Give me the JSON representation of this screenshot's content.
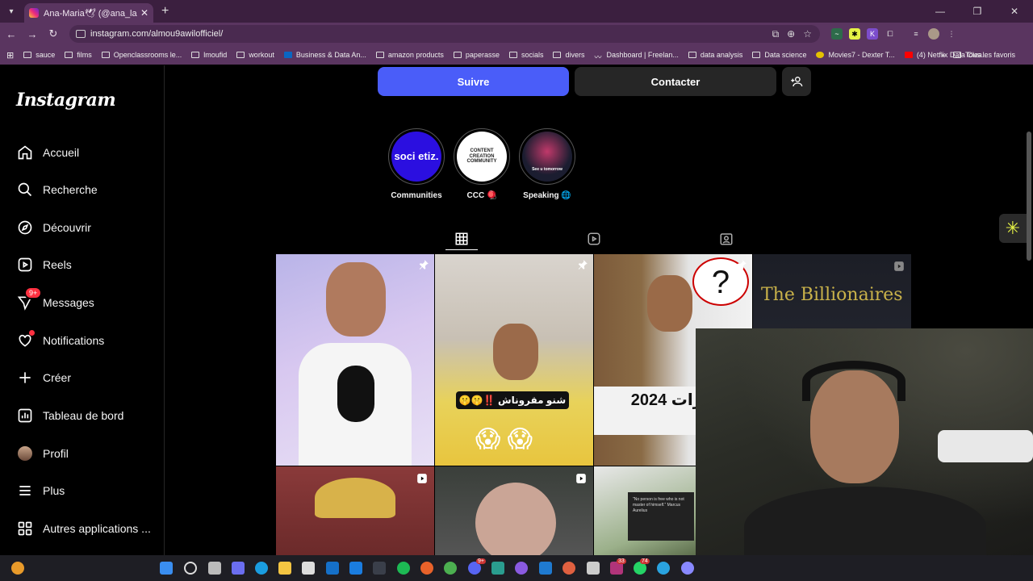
{
  "browser": {
    "tab_title": "Ana-Maria🕊 (@ana_lassalle) • Ph",
    "url": "instagram.com/almou9awilofficiel/",
    "bookmarks": [
      "sauce",
      "films",
      "Openclassrooms le...",
      "lmoufid",
      "workout",
      "Business & Data An...",
      "amazon products",
      "paperasse",
      "socials",
      "divers",
      "Dashboard | Freelan...",
      "data analysis",
      "Data science",
      "Movies7 - Dexter T...",
      "(4) Netflix Data Clea..."
    ],
    "bookmarks_right": "Tous les favoris"
  },
  "sidebar": {
    "logo": "Instagram",
    "items": [
      {
        "label": "Accueil",
        "icon": "home-icon"
      },
      {
        "label": "Recherche",
        "icon": "search-icon"
      },
      {
        "label": "Découvrir",
        "icon": "compass-icon"
      },
      {
        "label": "Reels",
        "icon": "reels-icon"
      },
      {
        "label": "Messages",
        "icon": "messenger-icon",
        "badge": "9+"
      },
      {
        "label": "Notifications",
        "icon": "heart-icon"
      },
      {
        "label": "Créer",
        "icon": "plus-icon"
      },
      {
        "label": "Tableau de bord",
        "icon": "dashboard-icon"
      },
      {
        "label": "Profil",
        "icon": "avatar-icon"
      },
      {
        "label": "Plus",
        "icon": "menu-icon"
      },
      {
        "label": "Autres applications ...",
        "icon": "apps-icon"
      }
    ]
  },
  "profile": {
    "follow_label": "Suivre",
    "contact_label": "Contacter",
    "highlights": [
      {
        "caption": "Communities",
        "text": "soci etiz."
      },
      {
        "caption": "CCC 🪀",
        "text": "CONTENT CREATION COMMUNITY"
      },
      {
        "caption": "Speaking 🌐",
        "text": "See u tomorrow"
      }
    ]
  },
  "posts": [
    {
      "overlay": ""
    },
    {
      "overlay": "شنو مقروناش ‼️🤫🤫"
    },
    {
      "overlay": "ن مهارات 2024"
    },
    {
      "overlay": "The Billionaires"
    },
    {
      "overlay": ""
    },
    {
      "overlay": ""
    },
    {
      "overlay": "\"No person is free who is not master of himself.\" Marcus Aurelius"
    }
  ],
  "taskbar": {
    "badges": [
      "33",
      "74",
      "9+"
    ]
  },
  "colors": {
    "follow": "#4a5df9",
    "contact": "#262626",
    "browser": "#5a3560"
  }
}
